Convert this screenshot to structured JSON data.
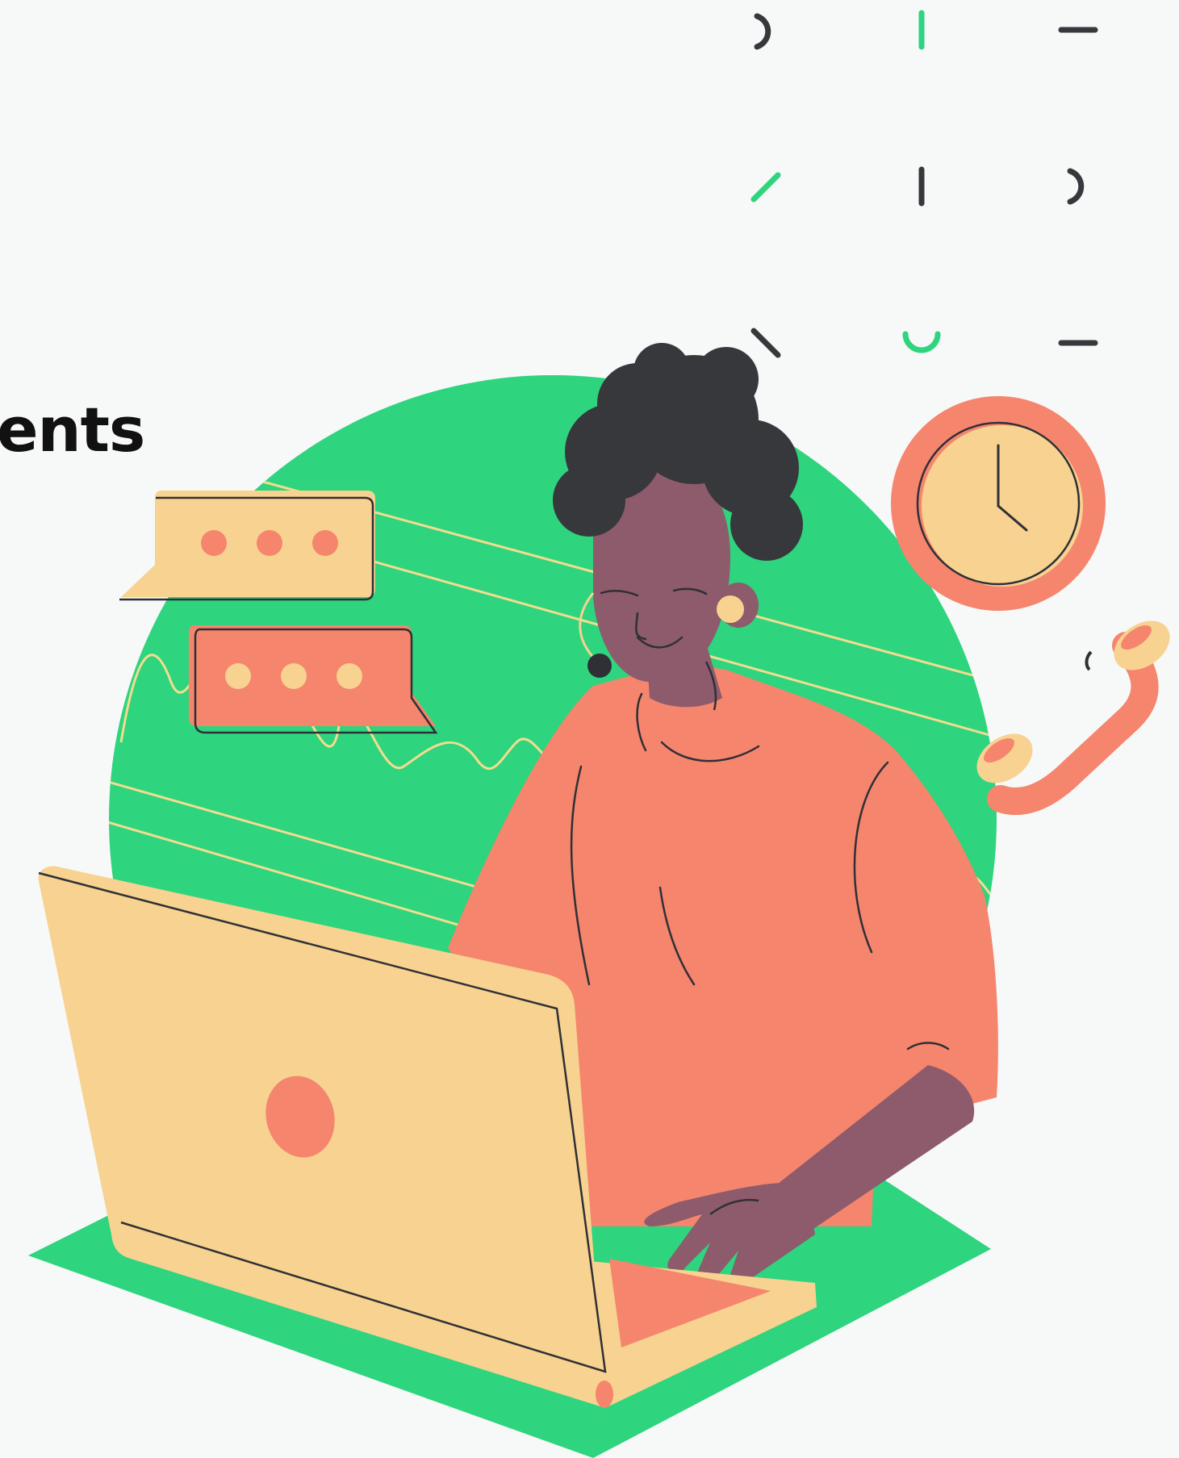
{
  "heading": {
    "visible_text": "ents"
  },
  "illustration": {
    "subject": "customer-support-agent",
    "elements": [
      "headset",
      "laptop",
      "chat-bubble-icon",
      "clock-icon",
      "phone-handset-icon",
      "decorative-dashes"
    ]
  },
  "colors": {
    "background": "#f7f8f8",
    "green": "#2ed47e",
    "coral": "#f5856d",
    "peach": "#f7d290",
    "skin": "#8d5b6b",
    "hair": "#37383c",
    "outline": "#2f3036",
    "accent_line": "#f2dd8f"
  }
}
